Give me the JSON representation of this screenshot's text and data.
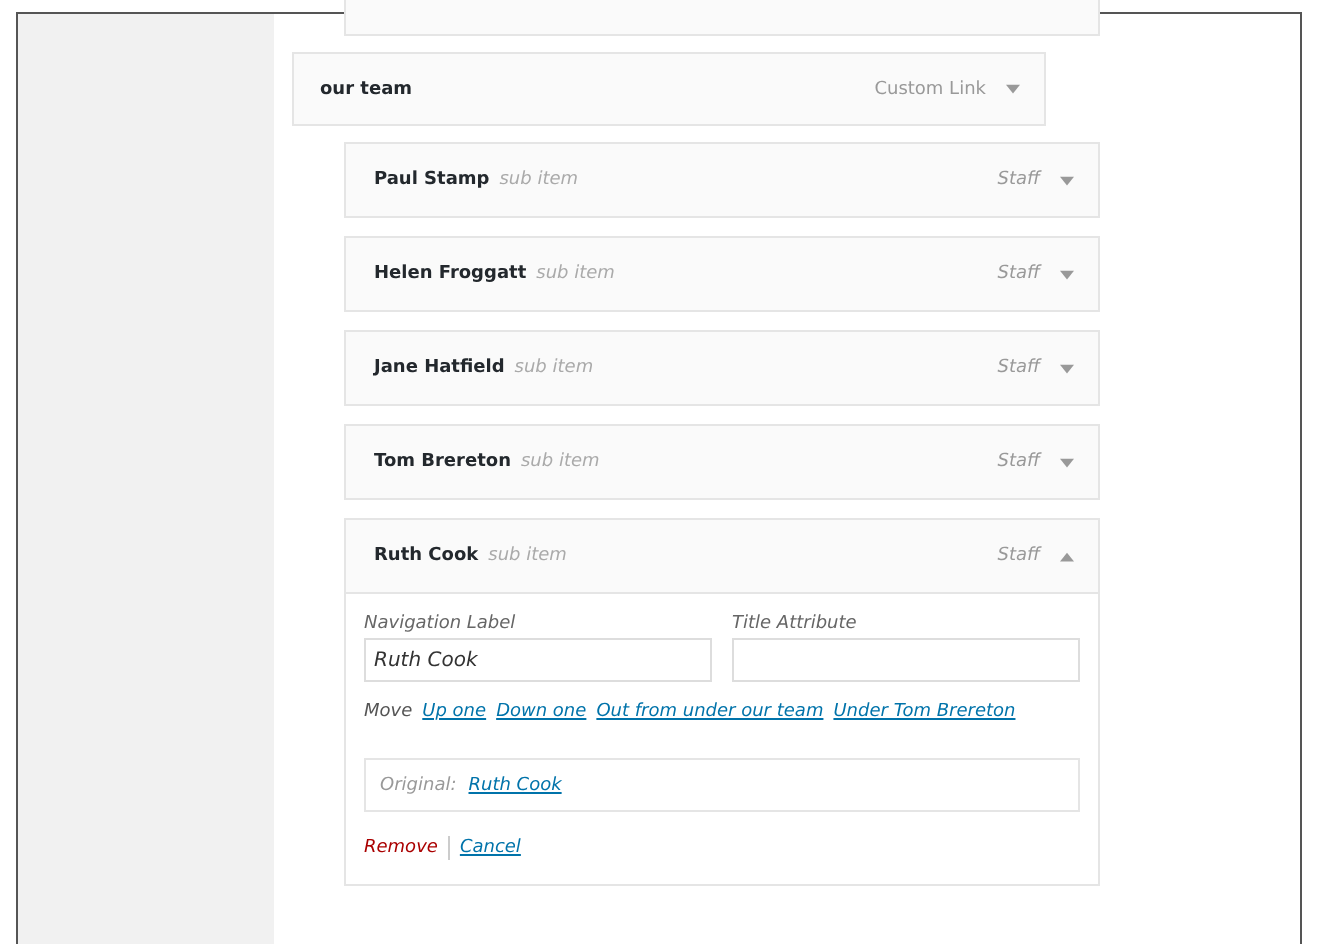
{
  "menu_items": [
    {
      "title": "our team",
      "type": "Custom Link",
      "expanded": false,
      "children": [
        {
          "title": "Paul Stamp",
          "subtitle": "sub item",
          "type": "Staff",
          "expanded": false
        },
        {
          "title": "Helen Froggatt",
          "subtitle": "sub item",
          "type": "Staff",
          "expanded": false
        },
        {
          "title": "Jane Hatfield",
          "subtitle": "sub item",
          "type": "Staff",
          "expanded": false
        },
        {
          "title": "Tom Brereton",
          "subtitle": "sub item",
          "type": "Staff",
          "expanded": false
        },
        {
          "title": "Ruth Cook",
          "subtitle": "sub item",
          "type": "Staff",
          "expanded": true,
          "settings": {
            "navigation_label": {
              "label": "Navigation Label",
              "value": "Ruth Cook"
            },
            "title_attribute": {
              "label": "Title Attribute"
            },
            "move": {
              "label": "Move",
              "links": [
                "Up one",
                "Down one",
                "Out from under our team",
                "Under Tom Brereton"
              ]
            },
            "original": {
              "label": "Original:",
              "link": "Ruth Cook"
            },
            "remove": "Remove",
            "cancel": "Cancel"
          }
        }
      ]
    }
  ]
}
